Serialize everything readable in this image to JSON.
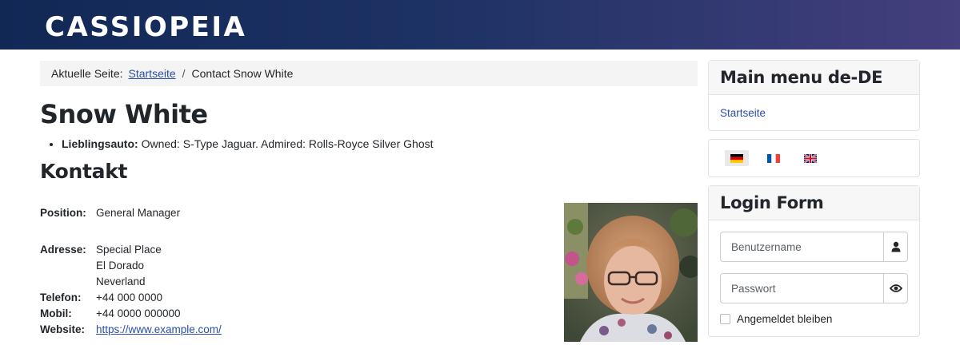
{
  "header": {
    "brand": "CASSIOPEIA"
  },
  "breadcrumb": {
    "prefix": "Aktuelle Seite:",
    "home": "Startseite",
    "separator": "/",
    "current": "Contact Snow White"
  },
  "contact": {
    "name": "Snow White",
    "tag_label": "Lieblingsauto:",
    "tag_value": "Owned: S-Type Jaguar. Admired: Rolls-Royce Silver Ghost",
    "section_title": "Kontakt",
    "position_label": "Position:",
    "position": "General Manager",
    "address_label": "Adresse:",
    "address": [
      "Special Place",
      "El Dorado",
      "Neverland"
    ],
    "phone_label": "Telefon:",
    "phone": "+44 000 0000",
    "mobile_label": "Mobil:",
    "mobile": "+44 0000 000000",
    "website_label": "Website:",
    "website": "https://www.example.com/"
  },
  "sidebar": {
    "menu_title": "Main menu de-DE",
    "menu_items": [
      {
        "label": "Startseite"
      }
    ],
    "languages": [
      {
        "icon": "german-flag-icon",
        "active": true
      },
      {
        "icon": "french-flag-icon",
        "active": false
      },
      {
        "icon": "uk-flag-icon",
        "active": false
      }
    ],
    "login": {
      "title": "Login Form",
      "username_placeholder": "Benutzername",
      "password_placeholder": "Passwort",
      "remember_label": "Angemeldet bleiben"
    }
  }
}
